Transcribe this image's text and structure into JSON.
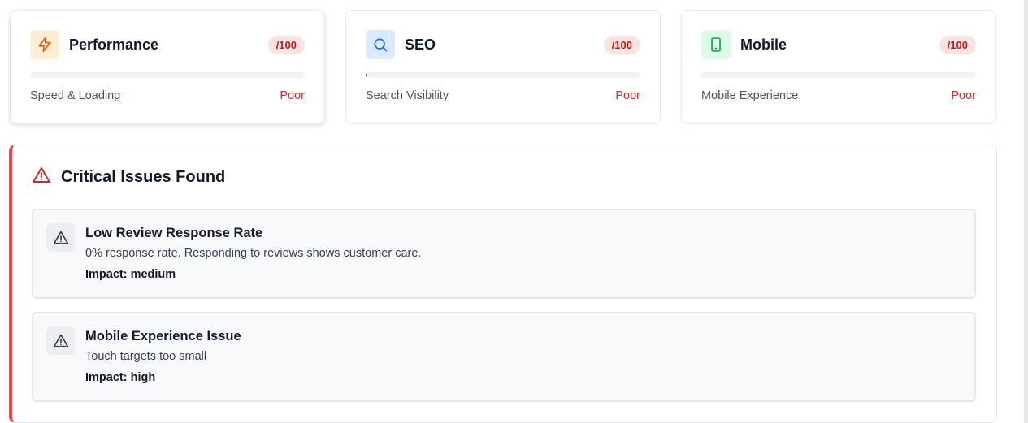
{
  "cards": [
    {
      "title": "Performance",
      "score_label": "/100",
      "subtitle": "Speed & Loading",
      "rating": "Poor",
      "icon": "lightning-icon",
      "progress": 0,
      "accent": "#ea580c",
      "icon_bg": "#ffedd5"
    },
    {
      "title": "SEO",
      "score_label": "/100",
      "subtitle": "Search Visibility",
      "rating": "Poor",
      "icon": "search-icon",
      "progress": 0,
      "accent": "#2563eb",
      "icon_bg": "#dbeafe"
    },
    {
      "title": "Mobile",
      "score_label": "/100",
      "subtitle": "Mobile Experience",
      "rating": "Poor",
      "icon": "smartphone-icon",
      "progress": 0,
      "accent": "#16a34a",
      "icon_bg": "#dcfce7"
    }
  ],
  "issues_section": {
    "title": "Critical Issues Found",
    "icon": "alert-triangle-icon",
    "items": [
      {
        "title": "Low Review Response Rate",
        "description": "0% response rate. Responding to reviews shows customer care.",
        "impact": "Impact: medium"
      },
      {
        "title": "Mobile Experience Issue",
        "description": "Touch targets too small",
        "impact": "Impact: high"
      }
    ]
  },
  "colors": {
    "critical": "#ef4444",
    "poor_text": "#dc2626",
    "badge_bg": "#fde2e2"
  }
}
